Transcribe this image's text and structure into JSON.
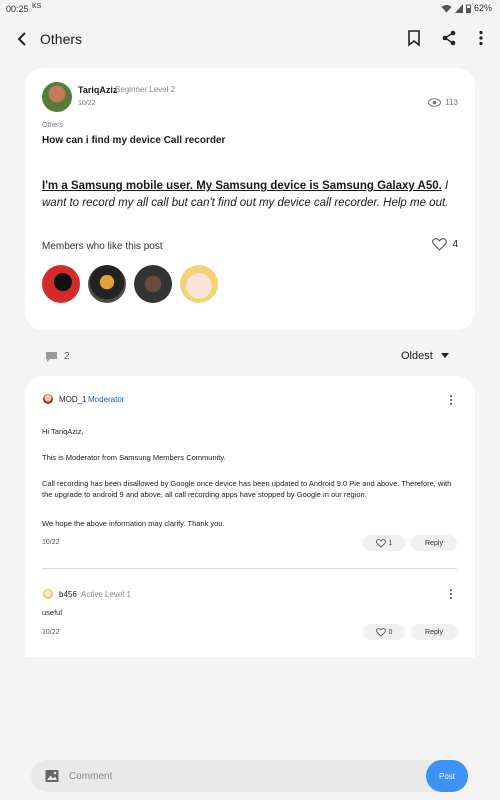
{
  "status_bar": {
    "time": "00:25",
    "carrier_icon_text": "KS",
    "battery": "62%"
  },
  "app_bar": {
    "title": "Others"
  },
  "post": {
    "author": "TariqAziz",
    "author_level": "Beginner Level 2",
    "date": "10/22",
    "views": "113",
    "category": "Others",
    "title": "How can i find my device Call recorder",
    "body_bold": "I'm a Samsung mobile user. My Samsung device is Samsung Galaxy A50.",
    "body_italic": " I want to record my all call but can't find out my device call recorder. Help me out.",
    "likes_label": "Members who like this post",
    "likes_count": "4"
  },
  "comments_header": {
    "count": "2",
    "sort": "Oldest"
  },
  "comments": [
    {
      "author": "MOD_1",
      "role": "Moderator",
      "paragraphs": [
        "Hi TariqAziz,",
        "This is Moderator from Samsung Members Community.",
        "Call recording has been disallowed by Google once device has been updated to Android 9.0 Pie and above. Therefore, with the upgrade to android 9 and above, all call recording apps have stopped by Google in our region.",
        "We hope the above information may clarify. Thank you."
      ],
      "date": "10/22",
      "likes": "1",
      "reply_label": "Reply"
    },
    {
      "author": "b456",
      "role": "Active Level 1",
      "paragraphs": [
        "useful"
      ],
      "date": "10/22",
      "likes": "0",
      "reply_label": "Reply"
    }
  ],
  "composer": {
    "placeholder": "Comment",
    "post_label": "Post"
  },
  "colors": {
    "accent": "#3e91f5",
    "moderator": "#1a5fd8",
    "background": "#f4f4f4"
  },
  "icons": [
    "back-icon",
    "bookmark-icon",
    "share-icon",
    "more-vert-icon",
    "eye-icon",
    "heart-icon",
    "comment-icon",
    "caret-down-icon",
    "image-icon"
  ]
}
